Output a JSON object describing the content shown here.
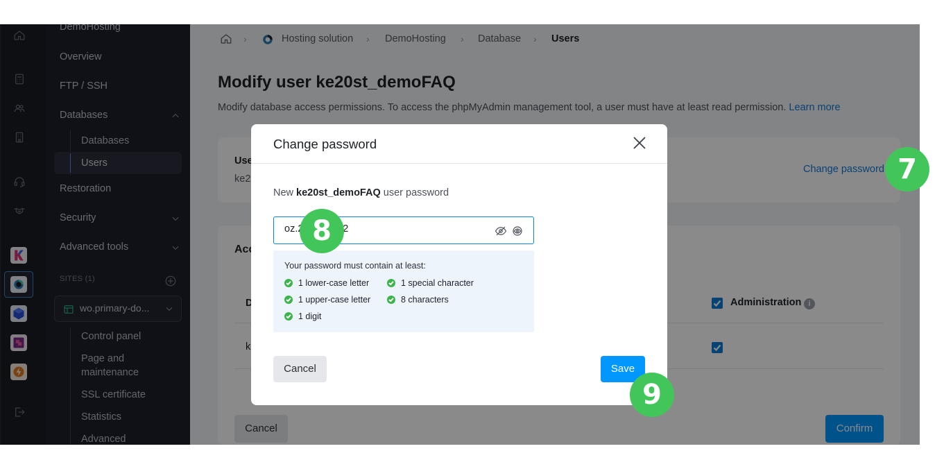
{
  "sidebar": {
    "product_title": "DemoHosting",
    "items": [
      {
        "label": "Overview"
      },
      {
        "label": "FTP / SSH"
      },
      {
        "label": "Databases"
      },
      {
        "label": "Restoration"
      },
      {
        "label": "Security"
      },
      {
        "label": "Advanced tools"
      }
    ],
    "database_sub": [
      {
        "label": "Databases"
      },
      {
        "label": "Users"
      }
    ],
    "sites_label": "SITES (1)",
    "site_select": "wo.primary-do...",
    "site_sub": [
      {
        "label": "Control panel"
      },
      {
        "label": "Page and"
      },
      {
        "label": "maintenance"
      },
      {
        "label": "SSL certificate"
      },
      {
        "label": "Statistics"
      },
      {
        "label": "Advanced"
      }
    ]
  },
  "breadcrumb": [
    "Hosting solution",
    "DemoHosting",
    "Database",
    "Users"
  ],
  "page": {
    "title": "Modify user ke20st_demoFAQ",
    "description": "Modify database access permissions. To access the phpMyAdmin management tool, a user must have at least read permission.",
    "learn_more": "Learn more",
    "user_card_label": "Use",
    "user_card_value": "ke2",
    "change_password_link": "Change password",
    "access_label": "Acc",
    "table_col_label": "D",
    "table_row_label": "k",
    "administration_label": "Administration",
    "cancel_label": "Cancel",
    "confirm_label": "Confirm"
  },
  "dialog": {
    "title": "Change password",
    "label_prefix": "New",
    "label_user": "ke20st_demoFAQ",
    "label_suffix": "user password",
    "password_value": "oz.2          #~2",
    "rules_title": "Your password must contain at least:",
    "rules": [
      "1 lower-case letter",
      "1 special character",
      "1 upper-case letter",
      "8 characters",
      "1 digit"
    ],
    "cancel_label": "Cancel",
    "save_label": "Save"
  },
  "badges": [
    "7",
    "8",
    "9"
  ],
  "colors": {
    "accent": "#0098ff",
    "link": "#1479d1",
    "badge_green": "#43c659",
    "rule_ok": "#3cb44b",
    "sidebar_bg": "#1e2029",
    "rail_bg": "#1b1d24"
  }
}
